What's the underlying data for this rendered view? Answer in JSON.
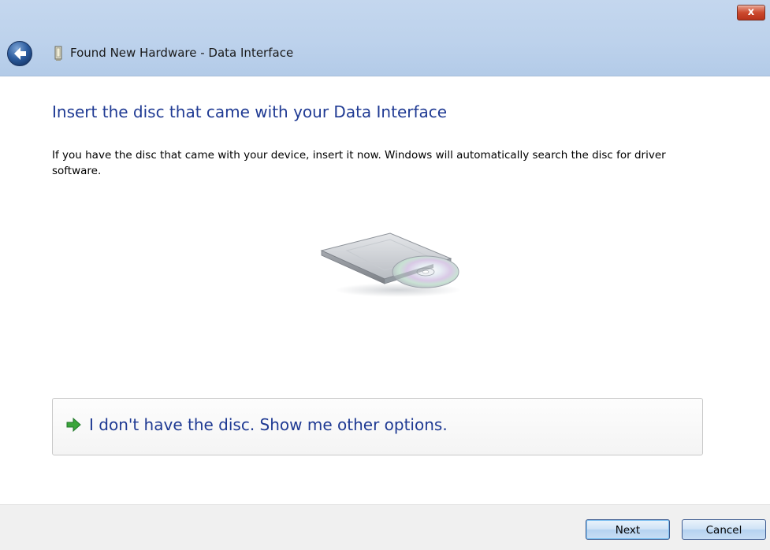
{
  "window": {
    "title": "Found New Hardware - Data Interface",
    "close_label": "x"
  },
  "content": {
    "heading": "Insert the disc that came with your Data Interface",
    "description": "If you have the disc that came with your device, insert it now.  Windows will automatically search the disc for driver software.",
    "illustration_icon": "disc-drive-icon"
  },
  "option": {
    "label": "I don't have the disc.  Show me other options.",
    "icon": "green-arrow-icon"
  },
  "footer": {
    "next_label": "Next",
    "cancel_label": "Cancel"
  },
  "colors": {
    "heading": "#1f3a93",
    "topbar": "#bdd2ec",
    "close_button": "#cc4a2e",
    "arrow": "#3aa53a"
  }
}
